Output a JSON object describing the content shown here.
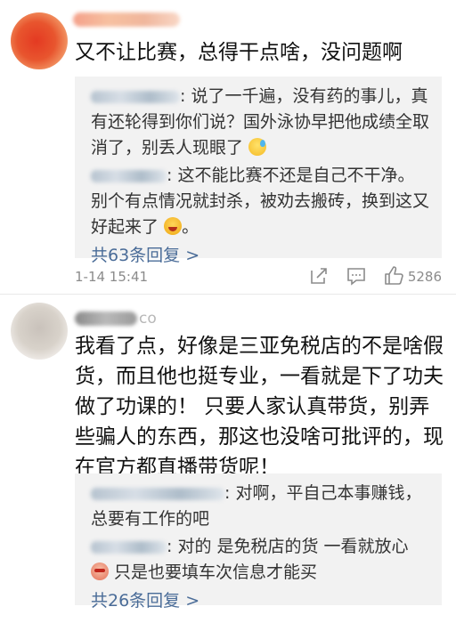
{
  "comments": [
    {
      "text": "又不让比赛，总得干点啥，没问题啊",
      "replies": [
        {
          "text": ": 说了一千遍，没有药的事儿，真有还轮得到你们说？国外泳协早把他成绩全取消了，别丢人现眼了",
          "emoji": "sweat-smile-emoji"
        },
        {
          "text": ": 这不能比赛不还是自己不干净。别个有点情况就封杀，被劝去搬砖，换到这又好起来了",
          "tail": "。",
          "emoji": "laughing-emoji"
        }
      ],
      "more_replies": "共63条回复 >",
      "time": "1-14 15:41",
      "like_count": "5286",
      "avatar_color": "#e43a22"
    },
    {
      "username_tail": "co",
      "text": "我看了点，好像是三亚免税店的不是啥假货，而且他也挺专业，一看就是下了功夫做了功课的！ 只要人家认真带货，别弄些骗人的东西，那这也没啥可批评的，现在官方都直播带货呢！",
      "replies": [
        {
          "text": ": 对啊，平自己本事赚钱，总要有工作的吧"
        },
        {
          "text": ": 对的 是免税店的货 一看就放心",
          "tail": " 只是也要填车次信息才能买",
          "emoji": "peeking-emoji"
        }
      ],
      "more_replies": "共26条回复 >",
      "avatar_color": "#c9c2bb"
    }
  ],
  "colors": {
    "link": "#4a6c98",
    "reply_bg": "#f2f2f2",
    "meta": "#8b8b8b"
  }
}
